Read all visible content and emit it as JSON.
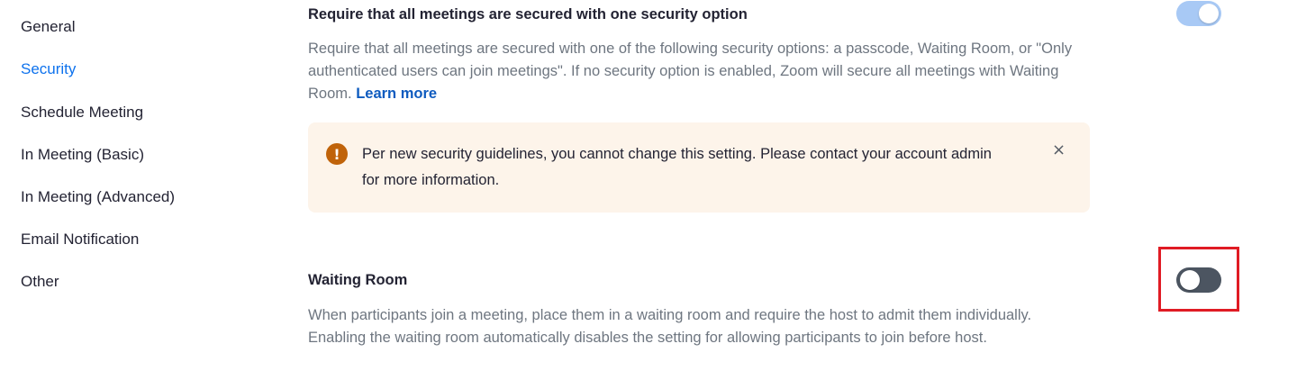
{
  "sidebar": {
    "items": [
      {
        "label": "General"
      },
      {
        "label": "Security"
      },
      {
        "label": "Schedule Meeting"
      },
      {
        "label": "In Meeting (Basic)"
      },
      {
        "label": "In Meeting (Advanced)"
      },
      {
        "label": "Email Notification"
      },
      {
        "label": "Other"
      }
    ],
    "active_item": "Security"
  },
  "settings": {
    "require_security": {
      "title": "Require that all meetings are secured with one security option",
      "description": "Require that all meetings are secured with one of the following security options: a passcode, Waiting Room, or \"Only authenticated users can join meetings\". If no security option is enabled, Zoom will secure all meetings with Waiting Room.",
      "link_label": "Learn more",
      "toggle_state": "on (disabled)"
    },
    "notice": {
      "icon": "exclamation-icon",
      "text": "Per new security guidelines, you cannot change this setting. Please contact your account admin for more information.",
      "close_icon": "×"
    },
    "waiting_room": {
      "title": "Waiting Room",
      "description": "When participants join a meeting, place them in a waiting room and require the host to admit them individually. Enabling the waiting room automatically disables the setting for allowing participants to join before host.",
      "toggle_state": "off"
    }
  },
  "colors": {
    "accent": "#0e72ed",
    "toggle_on_disabled": "#a8c9f5",
    "toggle_off": "#4c5561",
    "notice_bg": "#fdf4ea",
    "notice_icon": "#c0630a",
    "highlight_border": "#e01b24"
  }
}
